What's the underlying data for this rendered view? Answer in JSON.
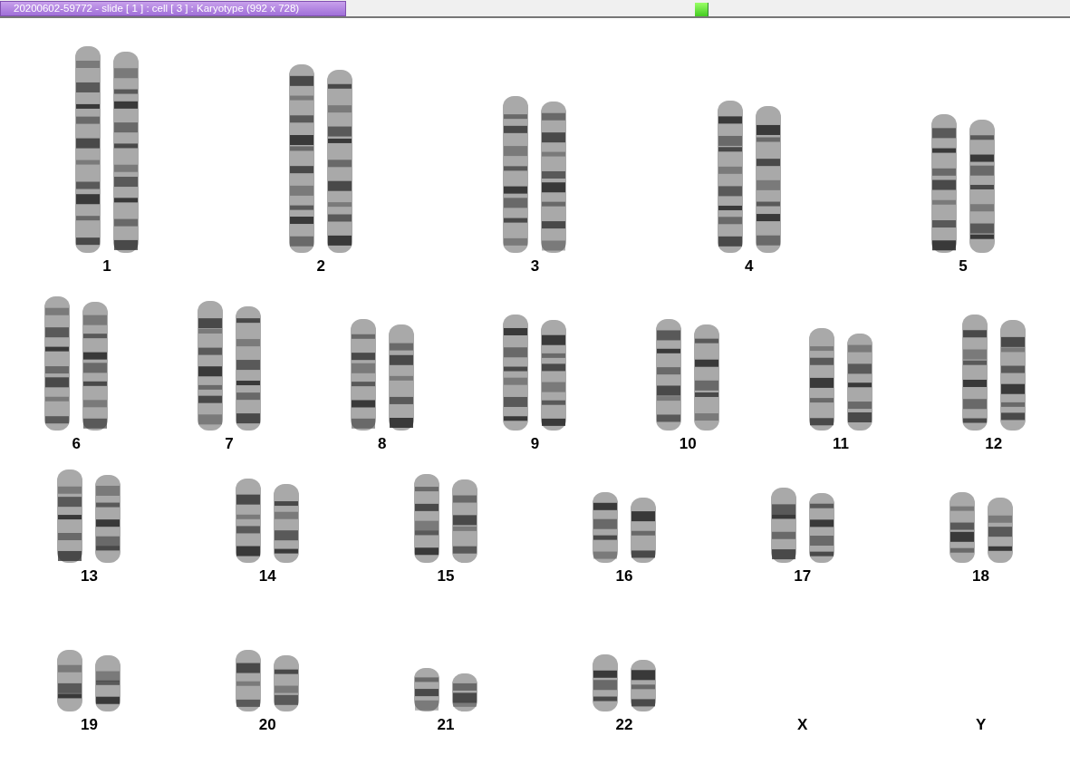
{
  "title_bar": {
    "title": "20200602-59772 - slide [ 1 ] : cell [ 3 ] : Karyotype  (992 x 728)"
  },
  "karyotype_rows": [
    {
      "items": [
        {
          "label": "1",
          "kind": "pair"
        },
        {
          "label": "2",
          "kind": "pair"
        },
        {
          "label": "3",
          "kind": "pair"
        },
        {
          "label": "4",
          "kind": "pair"
        },
        {
          "label": "5",
          "kind": "pair"
        }
      ]
    },
    {
      "items": [
        {
          "label": "6",
          "kind": "pair"
        },
        {
          "label": "7",
          "kind": "pair"
        },
        {
          "label": "8",
          "kind": "pair"
        },
        {
          "label": "9",
          "kind": "pair"
        },
        {
          "label": "10",
          "kind": "pair"
        },
        {
          "label": "11",
          "kind": "pair"
        },
        {
          "label": "12",
          "kind": "pair"
        }
      ]
    },
    {
      "items": [
        {
          "label": "13",
          "kind": "pair"
        },
        {
          "label": "14",
          "kind": "pair"
        },
        {
          "label": "15",
          "kind": "pair"
        },
        {
          "label": "16",
          "kind": "pair"
        },
        {
          "label": "17",
          "kind": "pair"
        },
        {
          "label": "18",
          "kind": "pair"
        }
      ]
    },
    {
      "items": [
        {
          "label": "19",
          "kind": "pair"
        },
        {
          "label": "20",
          "kind": "pair"
        },
        {
          "label": "21",
          "kind": "pair"
        },
        {
          "label": "22",
          "kind": "pair"
        },
        {
          "label": "X",
          "kind": "empty"
        },
        {
          "label": "Y",
          "kind": "empty"
        }
      ]
    }
  ]
}
